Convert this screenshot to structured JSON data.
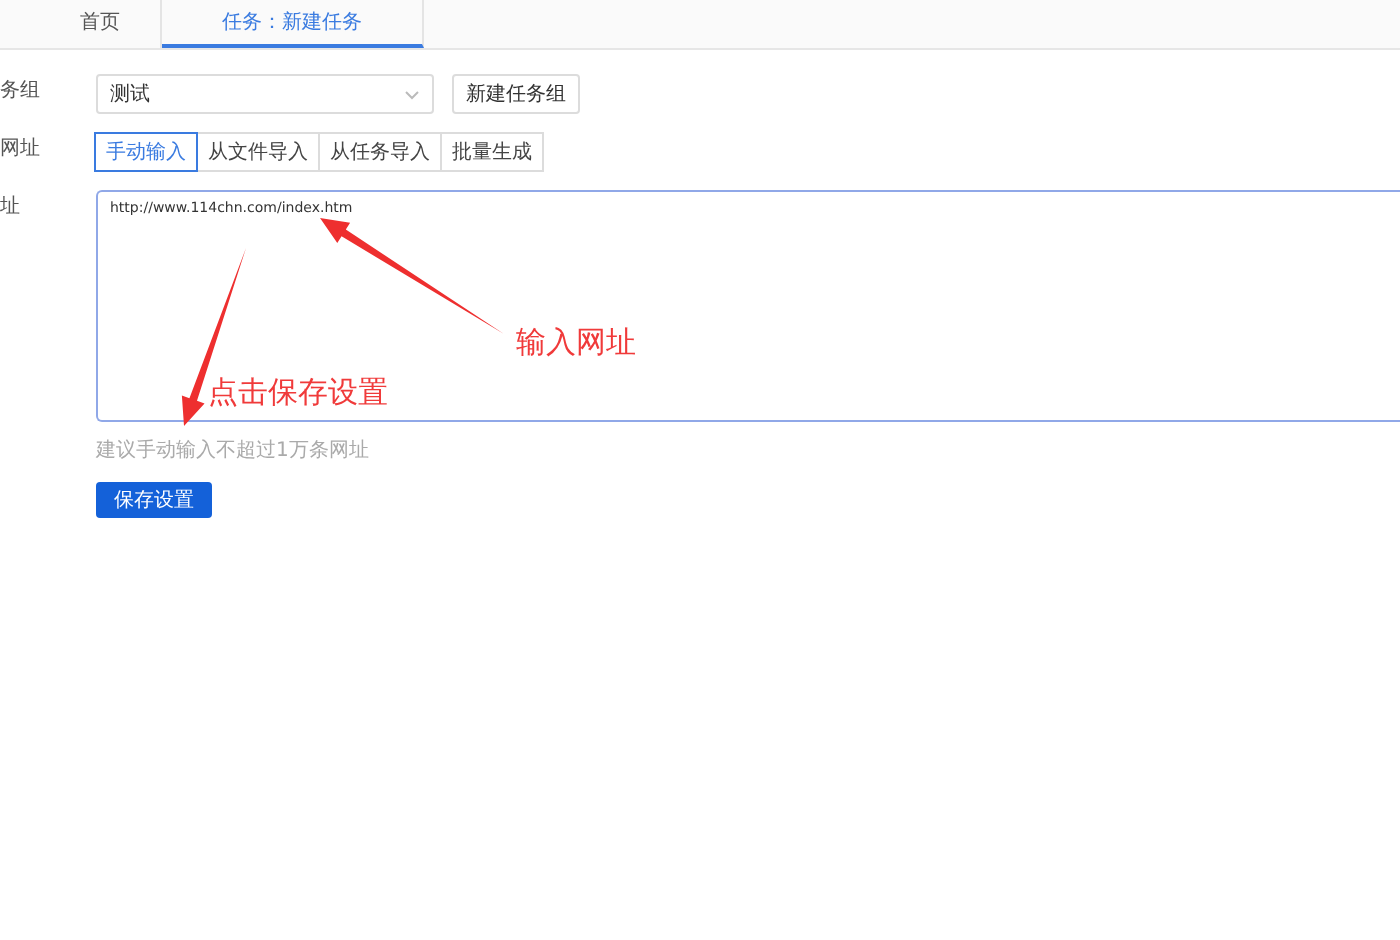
{
  "tabs": [
    {
      "label": "首页",
      "selected": false
    },
    {
      "label": "任务：新建任务",
      "selected": true
    }
  ],
  "form": {
    "rows": [
      {
        "label": "务组",
        "kind": "select",
        "value": "测试",
        "button": "新建任务组"
      },
      {
        "label": "网址",
        "kind": "segments",
        "options": [
          {
            "label": "手动输入",
            "selected": true
          },
          {
            "label": "从文件导入",
            "selected": false
          },
          {
            "label": "从任务导入",
            "selected": false
          },
          {
            "label": "批量生成",
            "selected": false
          }
        ]
      },
      {
        "label": "址",
        "kind": "textarea",
        "value": "http://www.114chn.com/index.htm"
      }
    ],
    "hint": "建议手动输入不超过1万条网址",
    "submit": "保存设置"
  },
  "annotations": [
    {
      "text": "输入网址"
    },
    {
      "text": "点击保存设置"
    }
  ]
}
